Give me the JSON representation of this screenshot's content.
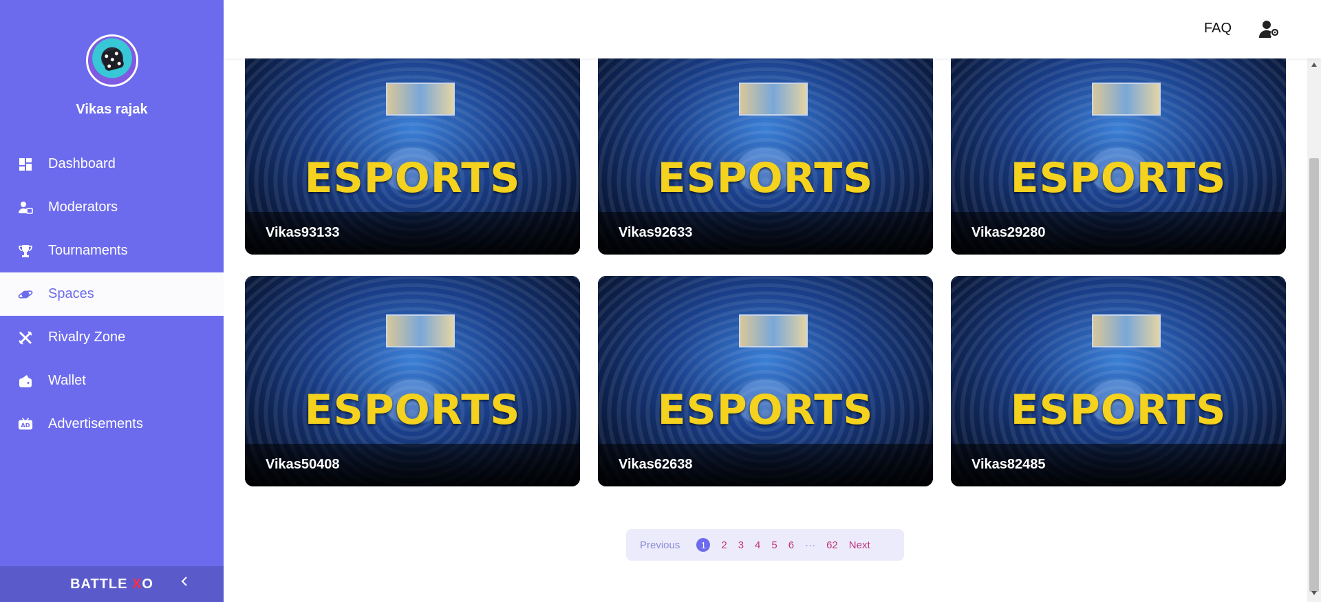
{
  "sidebar": {
    "username": "Vikas rajak",
    "items": [
      {
        "label": "Dashboard",
        "icon": "dashboard-icon"
      },
      {
        "label": "Moderators",
        "icon": "moderators-icon"
      },
      {
        "label": "Tournaments",
        "icon": "trophy-icon"
      },
      {
        "label": "Spaces",
        "icon": "planet-icon",
        "active": true
      },
      {
        "label": "Rivalry Zone",
        "icon": "crossed-swords-icon"
      },
      {
        "label": "Wallet",
        "icon": "wallet-icon"
      },
      {
        "label": "Advertisements",
        "icon": "ad-icon"
      }
    ],
    "brand": {
      "part1": "BATTLE",
      "part2": "X",
      "part3": "O"
    }
  },
  "header": {
    "faq_label": "FAQ",
    "user_settings_icon": "user-settings-icon"
  },
  "cards": [
    {
      "title": "Vikas93133",
      "image_text": "ESPORTS"
    },
    {
      "title": "Vikas92633",
      "image_text": "ESPORTS"
    },
    {
      "title": "Vikas29280",
      "image_text": "ESPORTS"
    },
    {
      "title": "Vikas50408",
      "image_text": "ESPORTS"
    },
    {
      "title": "Vikas62638",
      "image_text": "ESPORTS"
    },
    {
      "title": "Vikas82485",
      "image_text": "ESPORTS"
    }
  ],
  "pagination": {
    "previous": "Previous",
    "pages": [
      "1",
      "2",
      "3",
      "4",
      "5",
      "6"
    ],
    "ellipsis": "···",
    "last": "62",
    "next": "Next",
    "current": "1"
  },
  "colors": {
    "sidebar_bg": "#6c6bed",
    "accent": "#6c6bed",
    "esports_text": "#f4d21e",
    "page_link": "#c0357d"
  }
}
